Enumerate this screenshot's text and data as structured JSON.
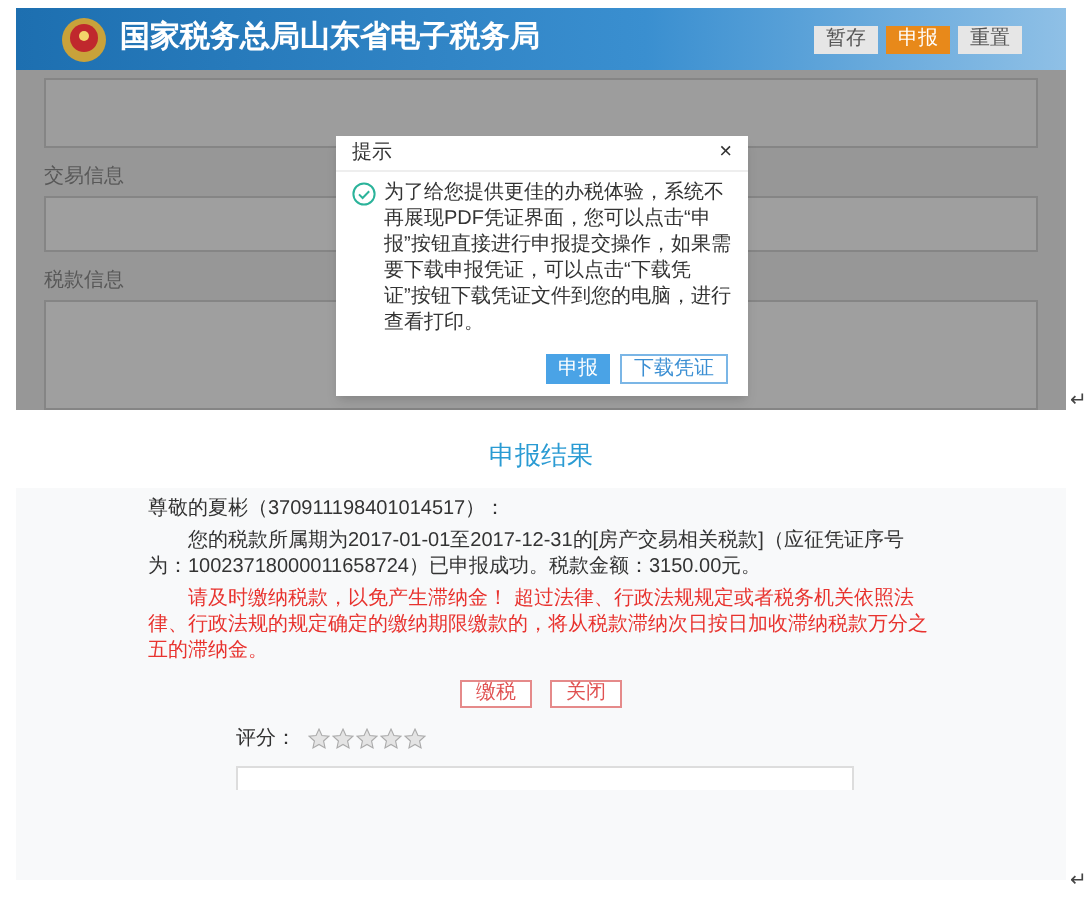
{
  "top_screen": {
    "site_title": "国家税务总局山东省电子税务局",
    "header_buttons": [
      {
        "label": "暂存",
        "kind": "normal"
      },
      {
        "label": "申报",
        "kind": "primary"
      },
      {
        "label": "重置",
        "kind": "normal"
      }
    ],
    "sections": [
      "交易信息",
      "税款信息"
    ],
    "dialog": {
      "title": "提示",
      "close": "×",
      "message": "为了给您提供更佳的办税体验，系统不再展现PDF凭证界面，您可以点击“申报”按钮直接进行申报提交操作，如果需要下载申报凭证，可以点击“下载凭证”按钮下载凭证文件到您的电脑，进行查看打印。",
      "buttons": [
        {
          "label": "申报",
          "kind": "primary"
        },
        {
          "label": "下载凭证",
          "kind": "outline"
        }
      ]
    }
  },
  "result_screen": {
    "title": "申报结果",
    "greeting": "尊敬的夏彬（370911198401014517）：",
    "message": "您的税款所属期为2017-01-01至2017-12-31的[房产交易相关税款]（应征凭证序号为：10023718000011658724）已申报成功。税款金额：3150.00元。",
    "warning": "请及时缴纳税款，以免产生滞纳金！ 超过法律、行政法规规定或者税务机关依照法律、行政法规的规定确定的缴纳期限缴款的，将从税款滞纳次日按日加收滞纳税款万分之五的滞纳金。",
    "buttons": [
      "缴税",
      "关闭"
    ],
    "rating": {
      "label": "评分：",
      "stars": 0
    }
  },
  "paragraph_marks": [
    "↵",
    "↵"
  ]
}
